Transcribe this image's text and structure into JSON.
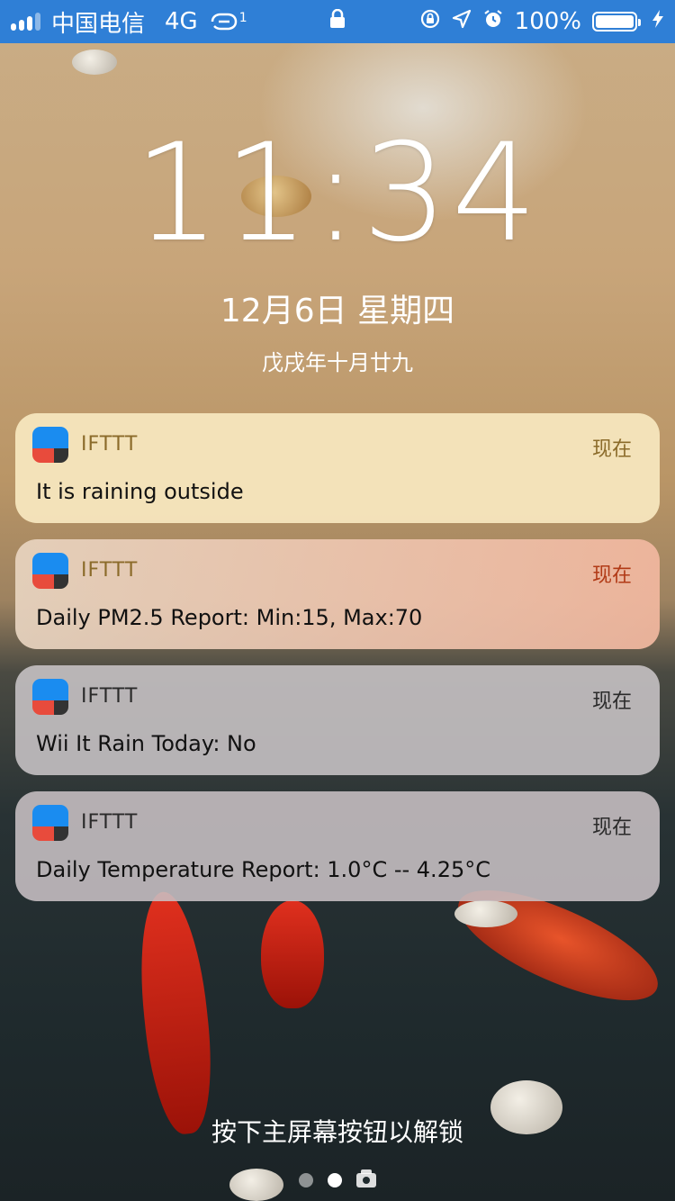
{
  "status_bar": {
    "carrier": "中国电信",
    "network": "4G",
    "hotspot_count": "1",
    "battery_percent": "100%",
    "battery_level": 1.0,
    "background_color": "#2f7fd6",
    "icons": [
      "signal-icon",
      "hotspot-icon",
      "lock-icon",
      "rotation-lock-icon",
      "location-icon",
      "alarm-icon",
      "battery-icon",
      "charging-icon"
    ]
  },
  "lockscreen": {
    "time": "11:34",
    "date": "12月6日 星期四",
    "lunar_date": "戊戌年十月廿九",
    "unlock_hint": "按下主屏幕按钮以解锁"
  },
  "notifications": [
    {
      "app": "IFTTT",
      "time": "现在",
      "message": "It is raining outside"
    },
    {
      "app": "IFTTT",
      "time": "现在",
      "message": "Daily PM2.5 Report: Min:15, Max:70"
    },
    {
      "app": "IFTTT",
      "time": "现在",
      "message": "Wii It Rain Today: No"
    },
    {
      "app": "IFTTT",
      "time": "现在",
      "message": "Daily Temperature Report: 1.0°C -- 4.25°C"
    }
  ],
  "pager": {
    "pages": 2,
    "active_page": 2,
    "icons": [
      "camera-icon"
    ]
  },
  "colors": {
    "ifttt_blue": "#1a8cf0",
    "ifttt_red": "#e84b3c",
    "ifttt_dark": "#333333"
  }
}
